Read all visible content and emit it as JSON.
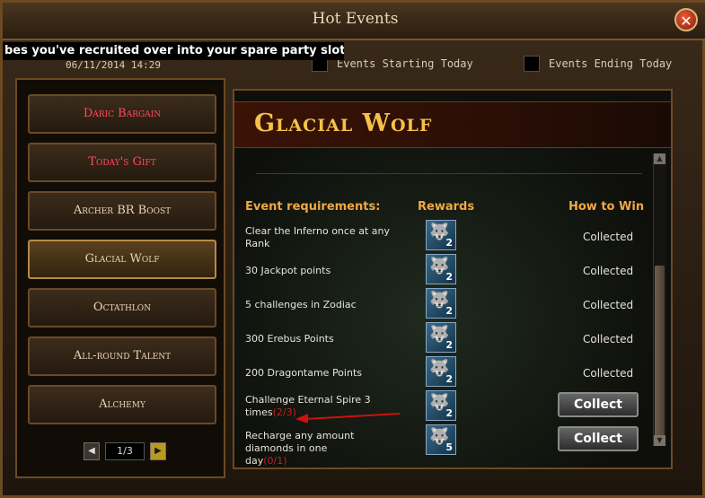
{
  "window": {
    "title": "Hot Events",
    "close_label": "✕"
  },
  "tooltip": "bes you've recruited over into your spare party slots.",
  "date_text": "06/11/2014 14:29",
  "filters": [
    {
      "label": "Events Starting Today",
      "checked": false
    },
    {
      "label": "Events Ending Today",
      "checked": false
    }
  ],
  "events": [
    {
      "label": "Daric Bargain",
      "color": "red"
    },
    {
      "label": "Today's Gift",
      "color": "red"
    },
    {
      "label": "Archer BR Boost",
      "color": "normal"
    },
    {
      "label": "Glacial Wolf",
      "color": "normal",
      "active": true
    },
    {
      "label": "Octathlon",
      "color": "normal"
    },
    {
      "label": "All-round Talent",
      "color": "normal"
    },
    {
      "label": "Alchemy",
      "color": "normal"
    }
  ],
  "pager": {
    "text": "1/3",
    "prev": "◀",
    "next": "▶"
  },
  "detail": {
    "title": "Glacial Wolf",
    "headers": {
      "requirements": "Event requirements:",
      "rewards": "Rewards",
      "how_to_win": "How to Win"
    },
    "rows": [
      {
        "req": "Clear the Inferno once at any Rank",
        "progress": "",
        "reward_count": "2",
        "status": "Collected"
      },
      {
        "req": "30 Jackpot points",
        "progress": "",
        "reward_count": "2",
        "status": "Collected"
      },
      {
        "req": "5 challenges in Zodiac",
        "progress": "",
        "reward_count": "2",
        "status": "Collected"
      },
      {
        "req": "300 Erebus Points",
        "progress": "",
        "reward_count": "2",
        "status": "Collected"
      },
      {
        "req": "200 Dragontame Points",
        "progress": "",
        "reward_count": "2",
        "status": "Collected"
      },
      {
        "req": "Challenge Eternal Spire 3 times",
        "progress": "(2/3)",
        "reward_count": "2",
        "status": "Collect"
      },
      {
        "req": "Recharge any amount diamonds in one day",
        "progress": "(0/1)",
        "reward_count": "5",
        "status": "Collect"
      }
    ]
  },
  "reward_icon": "wolf-icon",
  "colors": {
    "accent": "#f0a842",
    "title": "#f4c24a",
    "progress": "#c8201e",
    "annotation_arrow": "#cc1111"
  }
}
